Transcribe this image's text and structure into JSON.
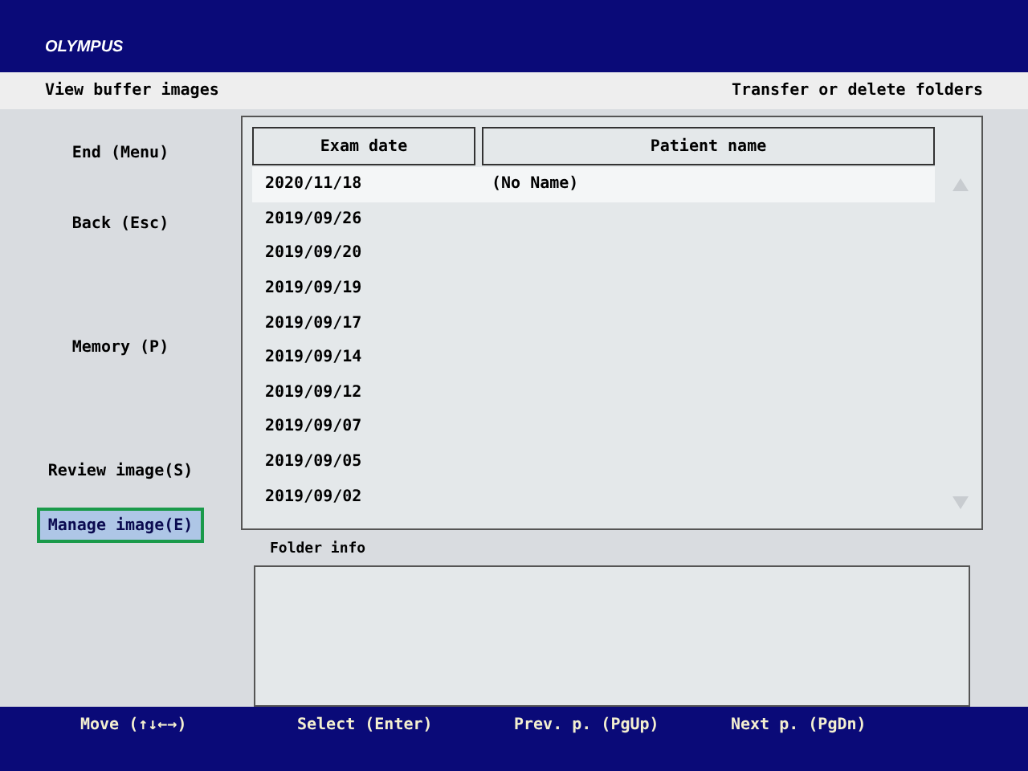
{
  "logo": "OLYMPUS",
  "header": {
    "title": "View buffer images",
    "action": "Transfer or delete folders"
  },
  "menu": [
    {
      "label": "End (Menu)",
      "selected": false
    },
    {
      "label": "Back (Esc)",
      "selected": false
    },
    {
      "label": "Memory (P)",
      "selected": false
    },
    {
      "label": "Review image(S)",
      "selected": false
    },
    {
      "label": "Manage image(E)",
      "selected": true
    }
  ],
  "table": {
    "columns": [
      "Exam date",
      "Patient name"
    ],
    "rows": [
      {
        "date": "2020/11/18",
        "name": "(No Name)",
        "selected": true
      },
      {
        "date": "2019/09/26",
        "selected": false
      },
      {
        "date": "2019/09/20",
        "selected": false
      },
      {
        "date": "2019/09/19",
        "selected": false
      },
      {
        "date": "2019/09/17",
        "selected": false
      },
      {
        "date": "2019/09/14",
        "selected": false
      },
      {
        "date": "2019/09/12",
        "selected": false
      },
      {
        "date": "2019/09/07",
        "selected": false
      },
      {
        "date": "2019/09/05",
        "selected": false
      },
      {
        "date": "2019/09/02",
        "selected": false
      }
    ]
  },
  "folder_info": {
    "label": "Folder info"
  },
  "footer": [
    "Move (↑↓←→)",
    "Select (Enter)",
    "Prev. p. (PgUp)",
    "Next p. (PgDn)"
  ]
}
